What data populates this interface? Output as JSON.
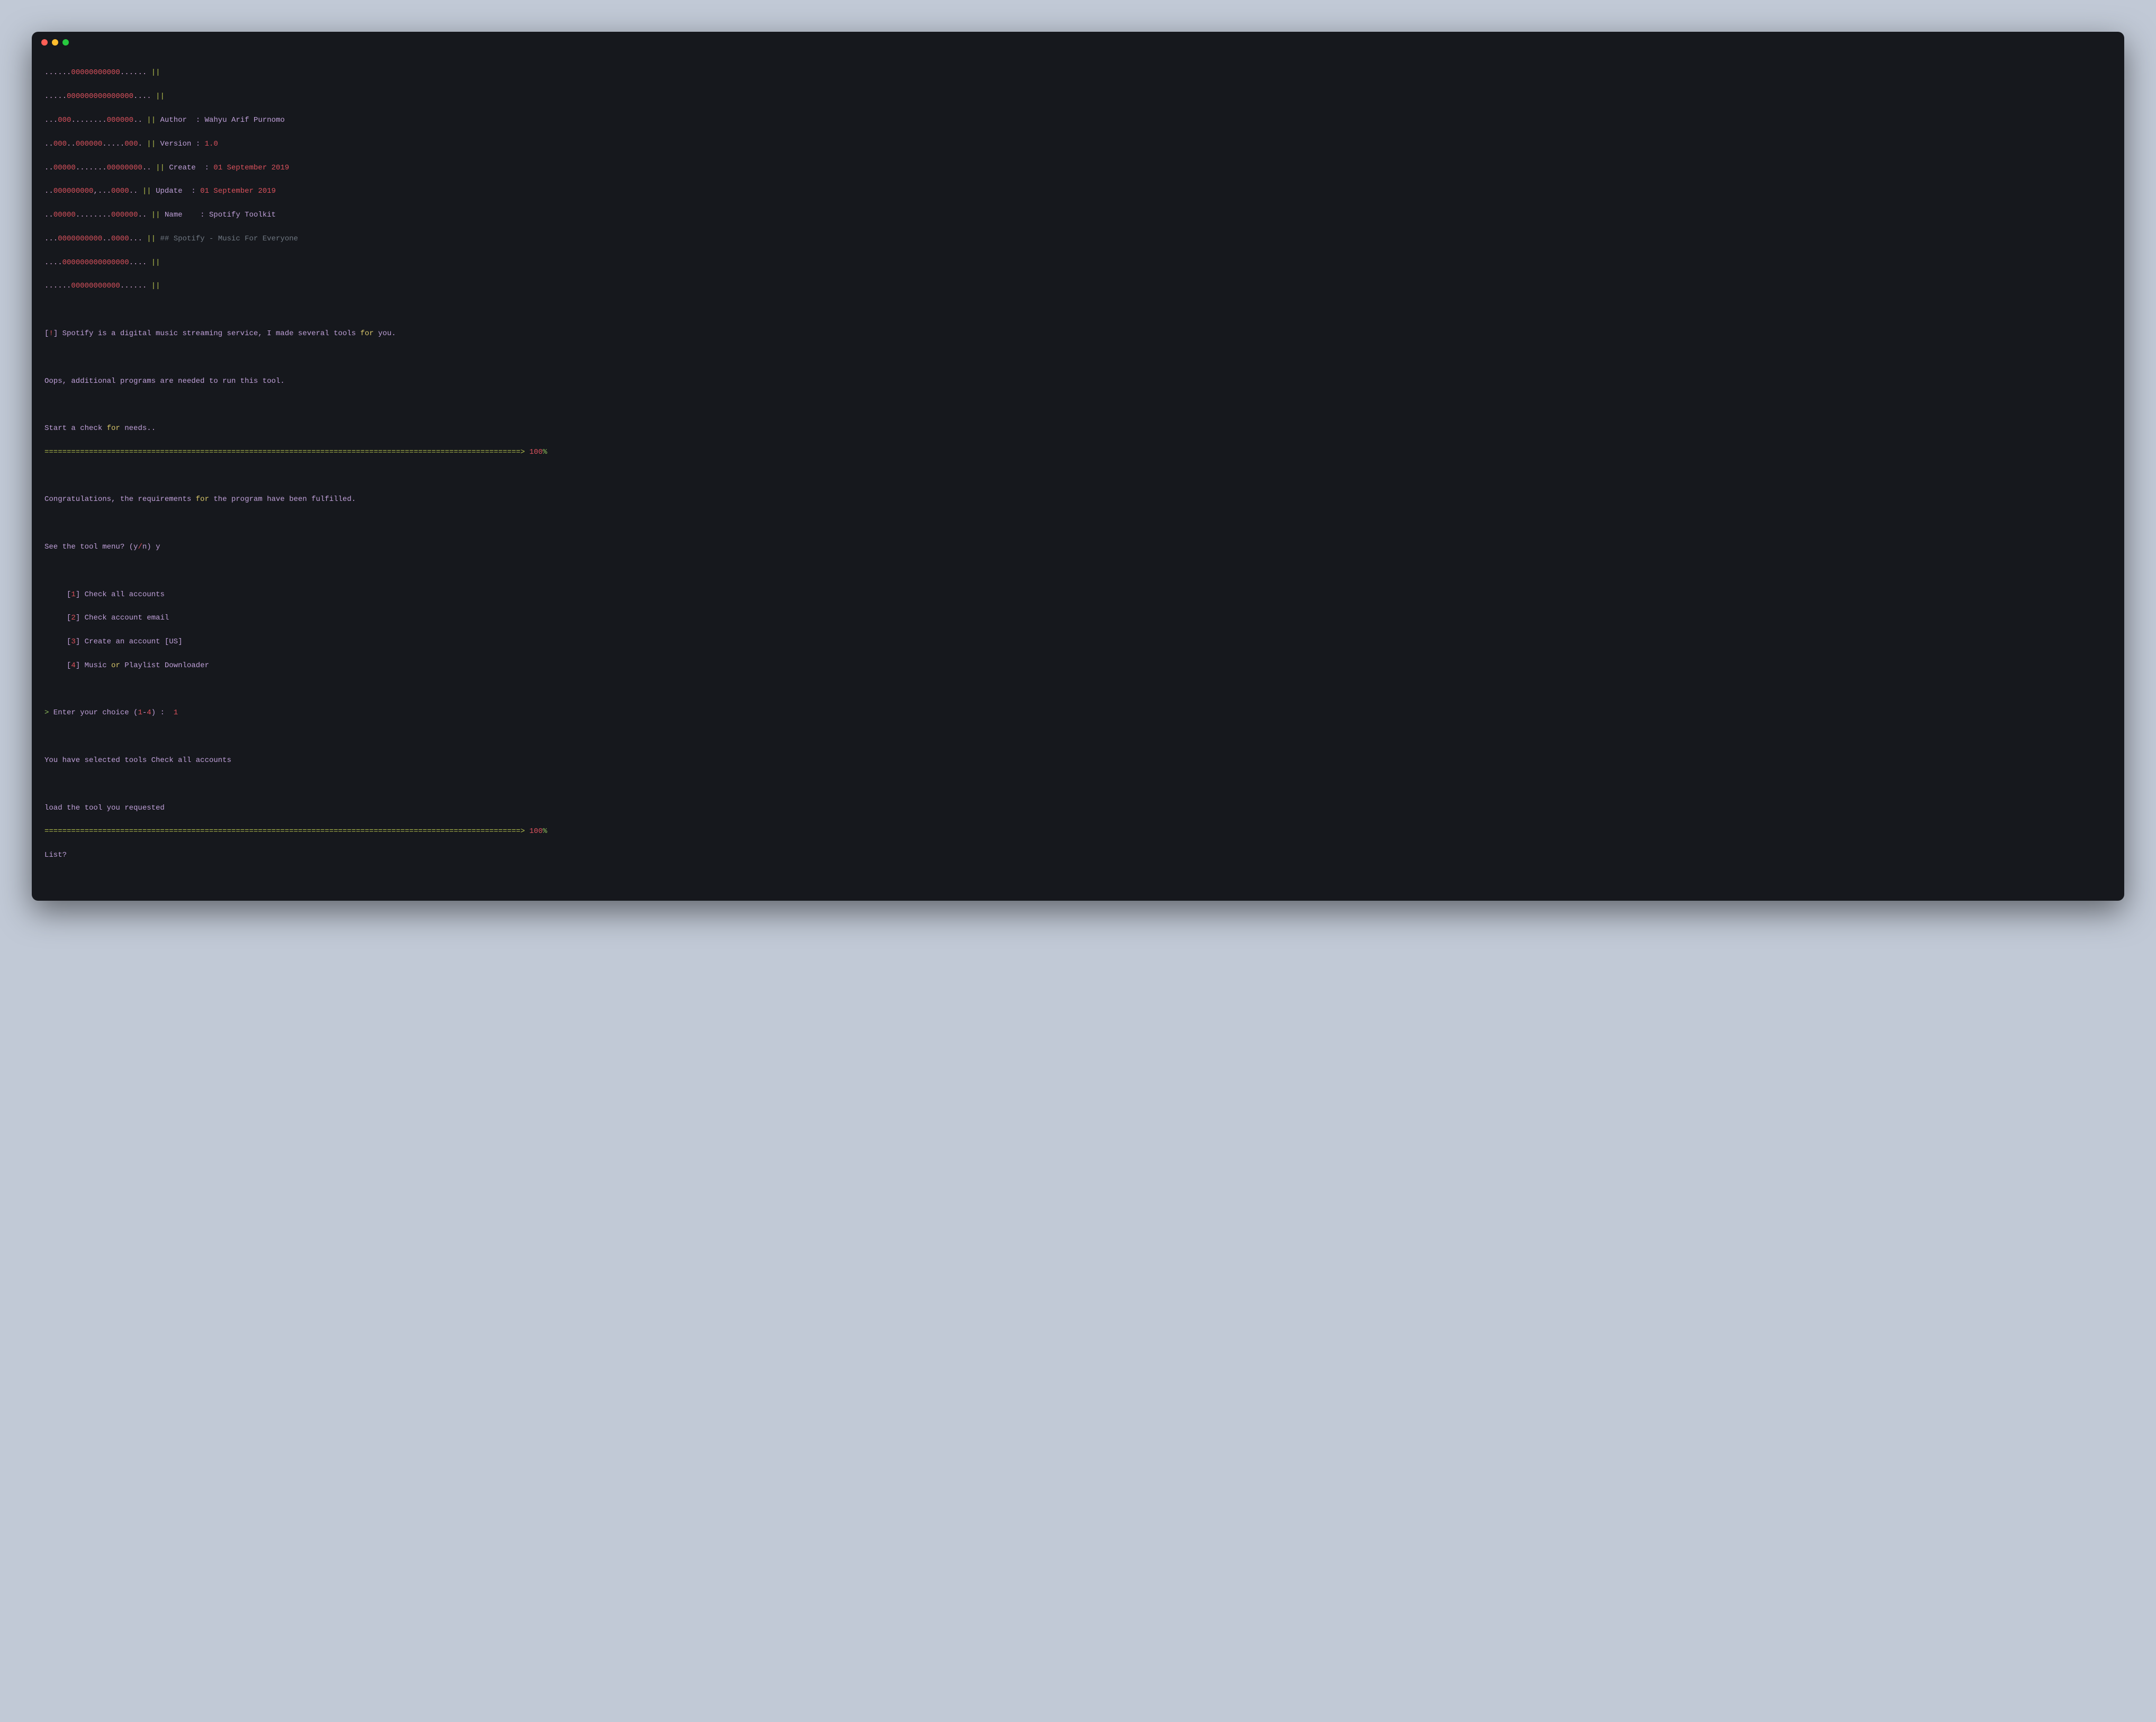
{
  "ascii": {
    "l1_a": "......",
    "l1_b": "00000000000",
    "l1_c": "......",
    "l2_a": ".....",
    "l2_b": "000000000000000",
    "l2_c": "....",
    "l3_a": "...",
    "l3_b": "000",
    "l3_c": "........",
    "l3_d": "000000",
    "l3_e": "..",
    "l4_a": "..",
    "l4_b": "000",
    "l4_c": "..",
    "l4_d": "000000",
    "l4_e": ".....",
    "l4_f": "000",
    "l4_g": ".",
    "l5_a": "..",
    "l5_b": "00000",
    "l5_c": ".......",
    "l5_d": "00000000",
    "l5_e": "..",
    "l6_a": "..",
    "l6_b": "000000000",
    "l6_c": ",...",
    "l6_d": "0000",
    "l6_e": "..",
    "l7_a": "..",
    "l7_b": "00000",
    "l7_c": "........",
    "l7_d": "000000",
    "l7_e": "..",
    "l8_a": "...",
    "l8_b": "0000000000",
    "l8_c": "..",
    "l8_d": "0000",
    "l8_e": "...",
    "l9_a": "....",
    "l9_b": "000000000000000",
    "l9_c": "....",
    "l10_a": "......",
    "l10_b": "00000000000",
    "l10_c": "......",
    "sep": " || "
  },
  "meta": {
    "author_label": "Author  : ",
    "author_value": "Wahyu Arif Purnomo",
    "version_label": "Version : ",
    "version_value": "1.0",
    "create_label": "Create  : ",
    "create_month": "01 September ",
    "create_year": "2019",
    "update_label": "Update  : ",
    "update_month": "01 September ",
    "update_year": "2019",
    "name_label": "Name    : ",
    "name_value": "Spotify Toolkit",
    "tagline": "## Spotify - Music For Everyone"
  },
  "lines": {
    "bang_open": "[",
    "bang": "!",
    "bang_close": "]",
    "intro_a": " Spotify is a digital music streaming service, I made several tools ",
    "intro_for": "for",
    "intro_b": " you.",
    "oops": "Oops, additional programs are needed to run this tool.",
    "start_a": "Start a check ",
    "start_for": "for",
    "start_b": " needs..",
    "congrats_a": "Congratulations, the requirements ",
    "congrats_for": "for",
    "congrats_b": " the program have been fulfilled.",
    "seemenu_a": "See the tool menu? ",
    "paren_open": "(",
    "yn_y": "y",
    "yn_slash": "/",
    "yn_n": "n",
    "paren_close": ")",
    "seemenu_ans": " y",
    "prompt_sym": ">",
    "enter_a": " Enter your choice ",
    "range_open": "(",
    "range_1": "1",
    "range_dash": "-",
    "range_4": "4",
    "range_close": ")",
    "enter_b": " :  ",
    "enter_ans": "1",
    "selected": "You have selected tools Check all accounts",
    "load": "load the tool you requested",
    "list": "List?",
    "bar": "===========================================================================================================>",
    "bar_pct": " 100",
    "bar_pct_sym": "%"
  },
  "menu": {
    "indent": "     ",
    "br_open": "[",
    "br_close": "]",
    "i1": "1",
    "t1": " Check all accounts",
    "i2": "2",
    "t2": " Check account email",
    "i3": "3",
    "t3_a": " Create an account ",
    "t3_b": "[",
    "t3_c": "US",
    "t3_d": "]",
    "i4": "4",
    "t4_a": " Music ",
    "t4_or": "or",
    "t4_b": " Playlist Downloader"
  }
}
